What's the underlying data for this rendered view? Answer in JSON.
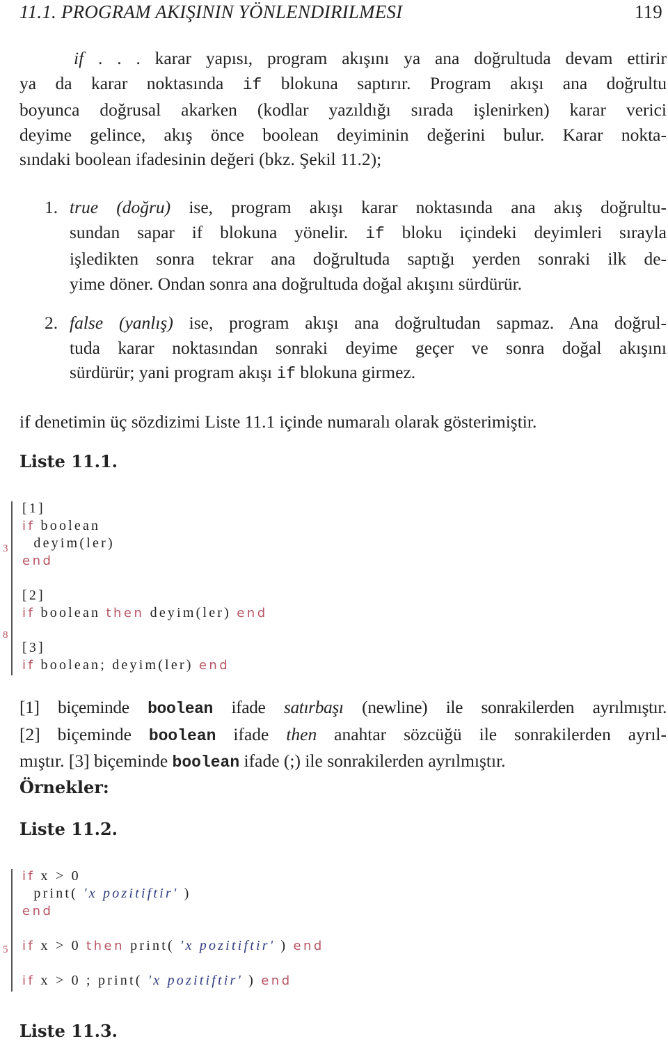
{
  "header": {
    "section_title": "11.1. PROGRAM AKIŞININ YÖNLENDIRILMESI",
    "page_number": "119"
  },
  "intro": {
    "l1_em": "if",
    "l1_rest": " . . . karar yapısı, program akışını ya ana doğrultuda devam ettirir",
    "l2_a": "ya da karar noktasında ",
    "l2_code": "if",
    "l2_b": " blokuna saptırır. Program akışı ana doğrultu",
    "l3": "boyunca doğrusal akarken (kodlar yazıldığı sırada işlenirken) karar verici",
    "l4": "deyime gelince, akış önce boolean deyiminin değerini bulur. Karar nokta-",
    "l5": "sındaki boolean ifadesinin değeri (bkz. Şekil 11.2);"
  },
  "enum": [
    {
      "number": "1.",
      "l1_em": "true (doğru)",
      "l1_rest": " ise, program akışı karar noktasında ana akış doğrultu-",
      "l2_a": "sundan sapar if blokuna yönelir. ",
      "l2_code": "if",
      "l2_b": " bloku içindeki deyimleri sırayla",
      "l3": "işledikten sonra tekrar ana doğrultuda saptığı yerden sonraki ilk de-",
      "l4": "yime döner. Ondan sonra ana doğrultuda doğal akışını sürdürür."
    },
    {
      "number": "2.",
      "l1_em": "false (yanlış)",
      "l1_rest": " ise, program akışı ana doğrultudan sapmaz. Ana doğrul-",
      "l2": "tuda karar noktasından sonraki deyime geçer ve sonra doğal akışını",
      "l3_a": "sürdürür; yani program akışı ",
      "l3_code": "if",
      "l3_b": " blokuna girmez."
    }
  ],
  "syntax_intro": "if denetimin üç sözdizimi Liste 11.1 içinde numaralı olarak gösterimiştir.",
  "listing1": {
    "title": "Liste 11.1.",
    "line_numbers": [
      "3",
      "8"
    ],
    "lines": {
      "l1": "[1]",
      "l2_kw": "if",
      "l2_rest": " boolean",
      "l3": "  deyim(ler)",
      "l4_kw": "end",
      "l6": "[2]",
      "l7_kw1": "if",
      "l7_a": " boolean ",
      "l7_kw2": "then",
      "l7_b": " deyim(ler) ",
      "l7_kw3": "end",
      "l9": "[3]",
      "l10_kw1": "if",
      "l10_a": " boolean; deyim(ler) ",
      "l10_kw2": "end"
    }
  },
  "explain": {
    "l1_a": "[1] biçeminde ",
    "l1_code": "boolean",
    "l1_b": " ifade ",
    "l1_em": "satırbaşı",
    "l1_c": " (newline) ile sonrakilerden ayrılmıştır.",
    "l2_a": "[2] biçeminde ",
    "l2_code": "boolean",
    "l2_b": " ifade ",
    "l2_em": "then",
    "l2_c": " anahtar sözcüğü ile sonrakilerden ayrıl-",
    "l3_a": "mıştır. [3] biçeminde ",
    "l3_code": "boolean",
    "l3_b": " ifade (;) ile sonrakilerden ayrılmıştır."
  },
  "examples_heading": "Örnekler:",
  "listing2": {
    "title": "Liste 11.2.",
    "line_number": "5",
    "lines": {
      "l1_kw": "if",
      "l1_rest": " x > 0",
      "l2_a": "  print( ",
      "l2_str": "'x pozitiftir'",
      "l2_b": " )",
      "l3_kw": "end",
      "l5_kw1": "if",
      "l5_a": " x > 0 ",
      "l5_kw2": "then",
      "l5_b": " print( ",
      "l5_str": "'x pozitiftir'",
      "l5_c": " ) ",
      "l5_kw3": "end",
      "l7_kw1": "if",
      "l7_a": " x > 0 ; print( ",
      "l7_str": "'x pozitiftir'",
      "l7_b": " ) ",
      "l7_kw2": "end"
    }
  },
  "listing3": {
    "title": "Liste 11.3."
  },
  "colors": {
    "keyword": "#b85463",
    "string": "#2e3b7e",
    "text": "#222222"
  }
}
